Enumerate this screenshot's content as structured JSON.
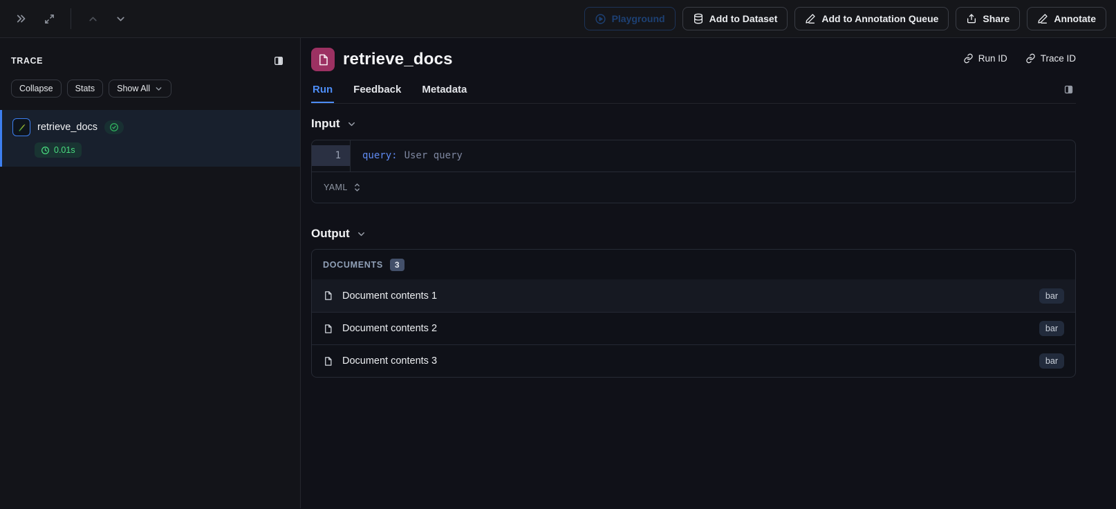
{
  "topbar": {
    "playground_label": "Playground",
    "add_to_dataset_label": "Add to Dataset",
    "add_to_annotation_queue_label": "Add to Annotation Queue",
    "share_label": "Share",
    "annotate_label": "Annotate"
  },
  "sidebar": {
    "title": "TRACE",
    "collapse_label": "Collapse",
    "stats_label": "Stats",
    "show_all_label": "Show All",
    "trace_item": {
      "name": "retrieve_docs",
      "duration": "0.01s"
    }
  },
  "main": {
    "title": "retrieve_docs",
    "run_id_label": "Run ID",
    "trace_id_label": "Trace ID",
    "tabs": [
      {
        "label": "Run"
      },
      {
        "label": "Feedback"
      },
      {
        "label": "Metadata"
      }
    ],
    "input": {
      "heading": "Input",
      "line_number": "1",
      "code_key": "query:",
      "code_value": "User query",
      "format_label": "YAML"
    },
    "output": {
      "heading": "Output",
      "documents_label": "DOCUMENTS",
      "documents_count": "3",
      "rows": [
        {
          "text": "Document contents 1",
          "badge": "bar"
        },
        {
          "text": "Document contents 2",
          "badge": "bar"
        },
        {
          "text": "Document contents 3",
          "badge": "bar"
        }
      ]
    }
  },
  "colors": {
    "accent_blue": "#3d7ff0",
    "success_green": "#4ade80",
    "doc_icon_pink": "#9c3162",
    "selected_row_bg": "#18202d"
  }
}
